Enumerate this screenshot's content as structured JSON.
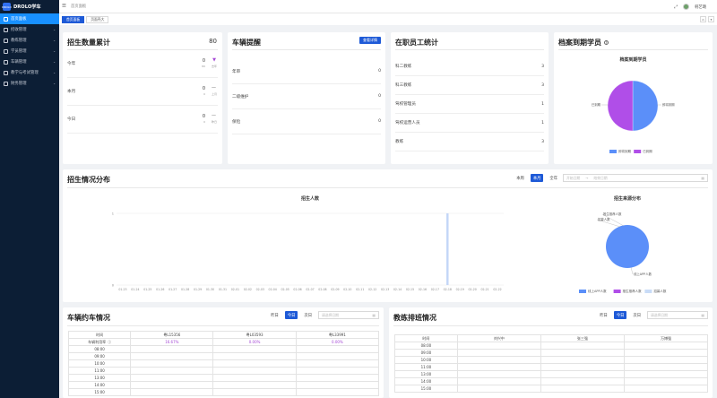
{
  "app": {
    "logo_mark": "DROLO",
    "title": "DROLO学车"
  },
  "sidebar": {
    "items": [
      {
        "label": "首页面板",
        "active": true,
        "has_children": false
      },
      {
        "label": "招收管理",
        "has_children": true
      },
      {
        "label": "教练管理",
        "has_children": true
      },
      {
        "label": "学员管理",
        "has_children": true
      },
      {
        "label": "车辆管理",
        "has_children": true
      },
      {
        "label": "教学与考试管理",
        "has_children": true
      },
      {
        "label": "财务管理",
        "has_children": true
      }
    ]
  },
  "header": {
    "breadcrumb": "首页面板",
    "username": "韩艺璐"
  },
  "tabs": [
    {
      "label": "首页面板",
      "active": true
    },
    {
      "label": "页面壳大",
      "active": false
    }
  ],
  "enroll_total": {
    "title": "招生数量累计",
    "total": "80",
    "rows": [
      {
        "label": "今年",
        "value": "0",
        "sub": "80",
        "trend": "▼",
        "trend_label": "去年"
      },
      {
        "label": "本月",
        "value": "0",
        "sub": "0",
        "trend": "—",
        "trend_label": "上月"
      },
      {
        "label": "今日",
        "value": "0",
        "sub": "0",
        "trend": "—",
        "trend_label": "昨日"
      }
    ]
  },
  "vehicle_alert": {
    "title": "车辆提醒",
    "button": "查看详情",
    "rows": [
      {
        "label": "年审",
        "value": "0"
      },
      {
        "label": "二级维护",
        "value": "0"
      },
      {
        "label": "保险",
        "value": "0"
      }
    ]
  },
  "staff": {
    "title": "在职员工统计",
    "rows": [
      {
        "label": "科二教练",
        "value": "3"
      },
      {
        "label": "科三教练",
        "value": "3"
      },
      {
        "label": "驾校管理员",
        "value": "1"
      },
      {
        "label": "驾校运营人员",
        "value": "1"
      },
      {
        "label": "教练",
        "value": "3"
      }
    ]
  },
  "archive": {
    "title": "档案到期学员",
    "chart_title": "档案到期学员",
    "slice_labels": [
      "已到期",
      "即将到期"
    ],
    "legend": [
      "即将到期",
      "已到期"
    ]
  },
  "enroll_dist": {
    "title": "招生情况分布",
    "segments": [
      "本周",
      "本月",
      "全年"
    ],
    "active_segment": "本月",
    "date_start": "开始日期",
    "date_end": "结束日期",
    "date_sep": "→"
  },
  "vehicle_booking": {
    "title": "车辆约车情况",
    "segments": [
      "昨日",
      "今日",
      "次日"
    ],
    "active_segment": "今日",
    "date_placeholder": "请选择日期",
    "columns": [
      "时间",
      "粤L15356",
      "粤L03593",
      "粤L33991"
    ],
    "rate_label": "车辆利用率",
    "rates": [
      "16.67%",
      "0.00%",
      "0.00%"
    ],
    "times": [
      "08:00",
      "09:00",
      "10:00",
      "11:00",
      "13:00",
      "14:00",
      "15:00"
    ]
  },
  "coach_schedule": {
    "title": "教练排班情况",
    "segments": [
      "昨日",
      "今日",
      "次日"
    ],
    "active_segment": "今日",
    "date_placeholder": "请选择日期",
    "columns": [
      "时间",
      "刘兴中",
      "张三强",
      "万博强"
    ],
    "times": [
      "08:00",
      "09:00",
      "10:00",
      "11:00",
      "13:00",
      "14:00",
      "15:00"
    ]
  },
  "colors": {
    "accent": "#1e5ad7",
    "pie_blue": "#5b8ff9",
    "pie_purple": "#b04ee8",
    "sidebar_bg": "#0c1e35"
  },
  "chart_data": [
    {
      "type": "bar",
      "title": "招生人数",
      "categories": [
        "01-23",
        "01-24",
        "01-25",
        "01-26",
        "01-27",
        "01-28",
        "01-29",
        "01-30",
        "01-31",
        "02-01",
        "02-02",
        "02-03",
        "02-04",
        "02-05",
        "02-06",
        "02-07",
        "02-08",
        "02-09",
        "02-10",
        "02-11",
        "02-12",
        "02-13",
        "02-14",
        "02-15",
        "02-16",
        "02-17",
        "02-18",
        "02-19",
        "02-20",
        "02-21",
        "02-22"
      ],
      "values": [
        0,
        0,
        0,
        0,
        0,
        0,
        0,
        0,
        0,
        0,
        0,
        0,
        0,
        0,
        0,
        0,
        0,
        0,
        0,
        0,
        0,
        0,
        0,
        0,
        0,
        0,
        1,
        0,
        0,
        0,
        0
      ],
      "ylim": [
        0,
        1
      ],
      "yticks": [
        "0",
        "1"
      ],
      "grid": true
    },
    {
      "type": "pie",
      "title": "招生来源分布",
      "labels": [
        "线上APP人数",
        "推生推荐人数",
        "招募人数"
      ],
      "values": [
        1,
        0,
        0
      ],
      "legend_position": "bottom"
    },
    {
      "type": "pie",
      "title": "档案到期学员",
      "labels": [
        "即将到期",
        "已到期"
      ],
      "values": [
        1,
        1
      ],
      "legend_position": "bottom"
    }
  ]
}
